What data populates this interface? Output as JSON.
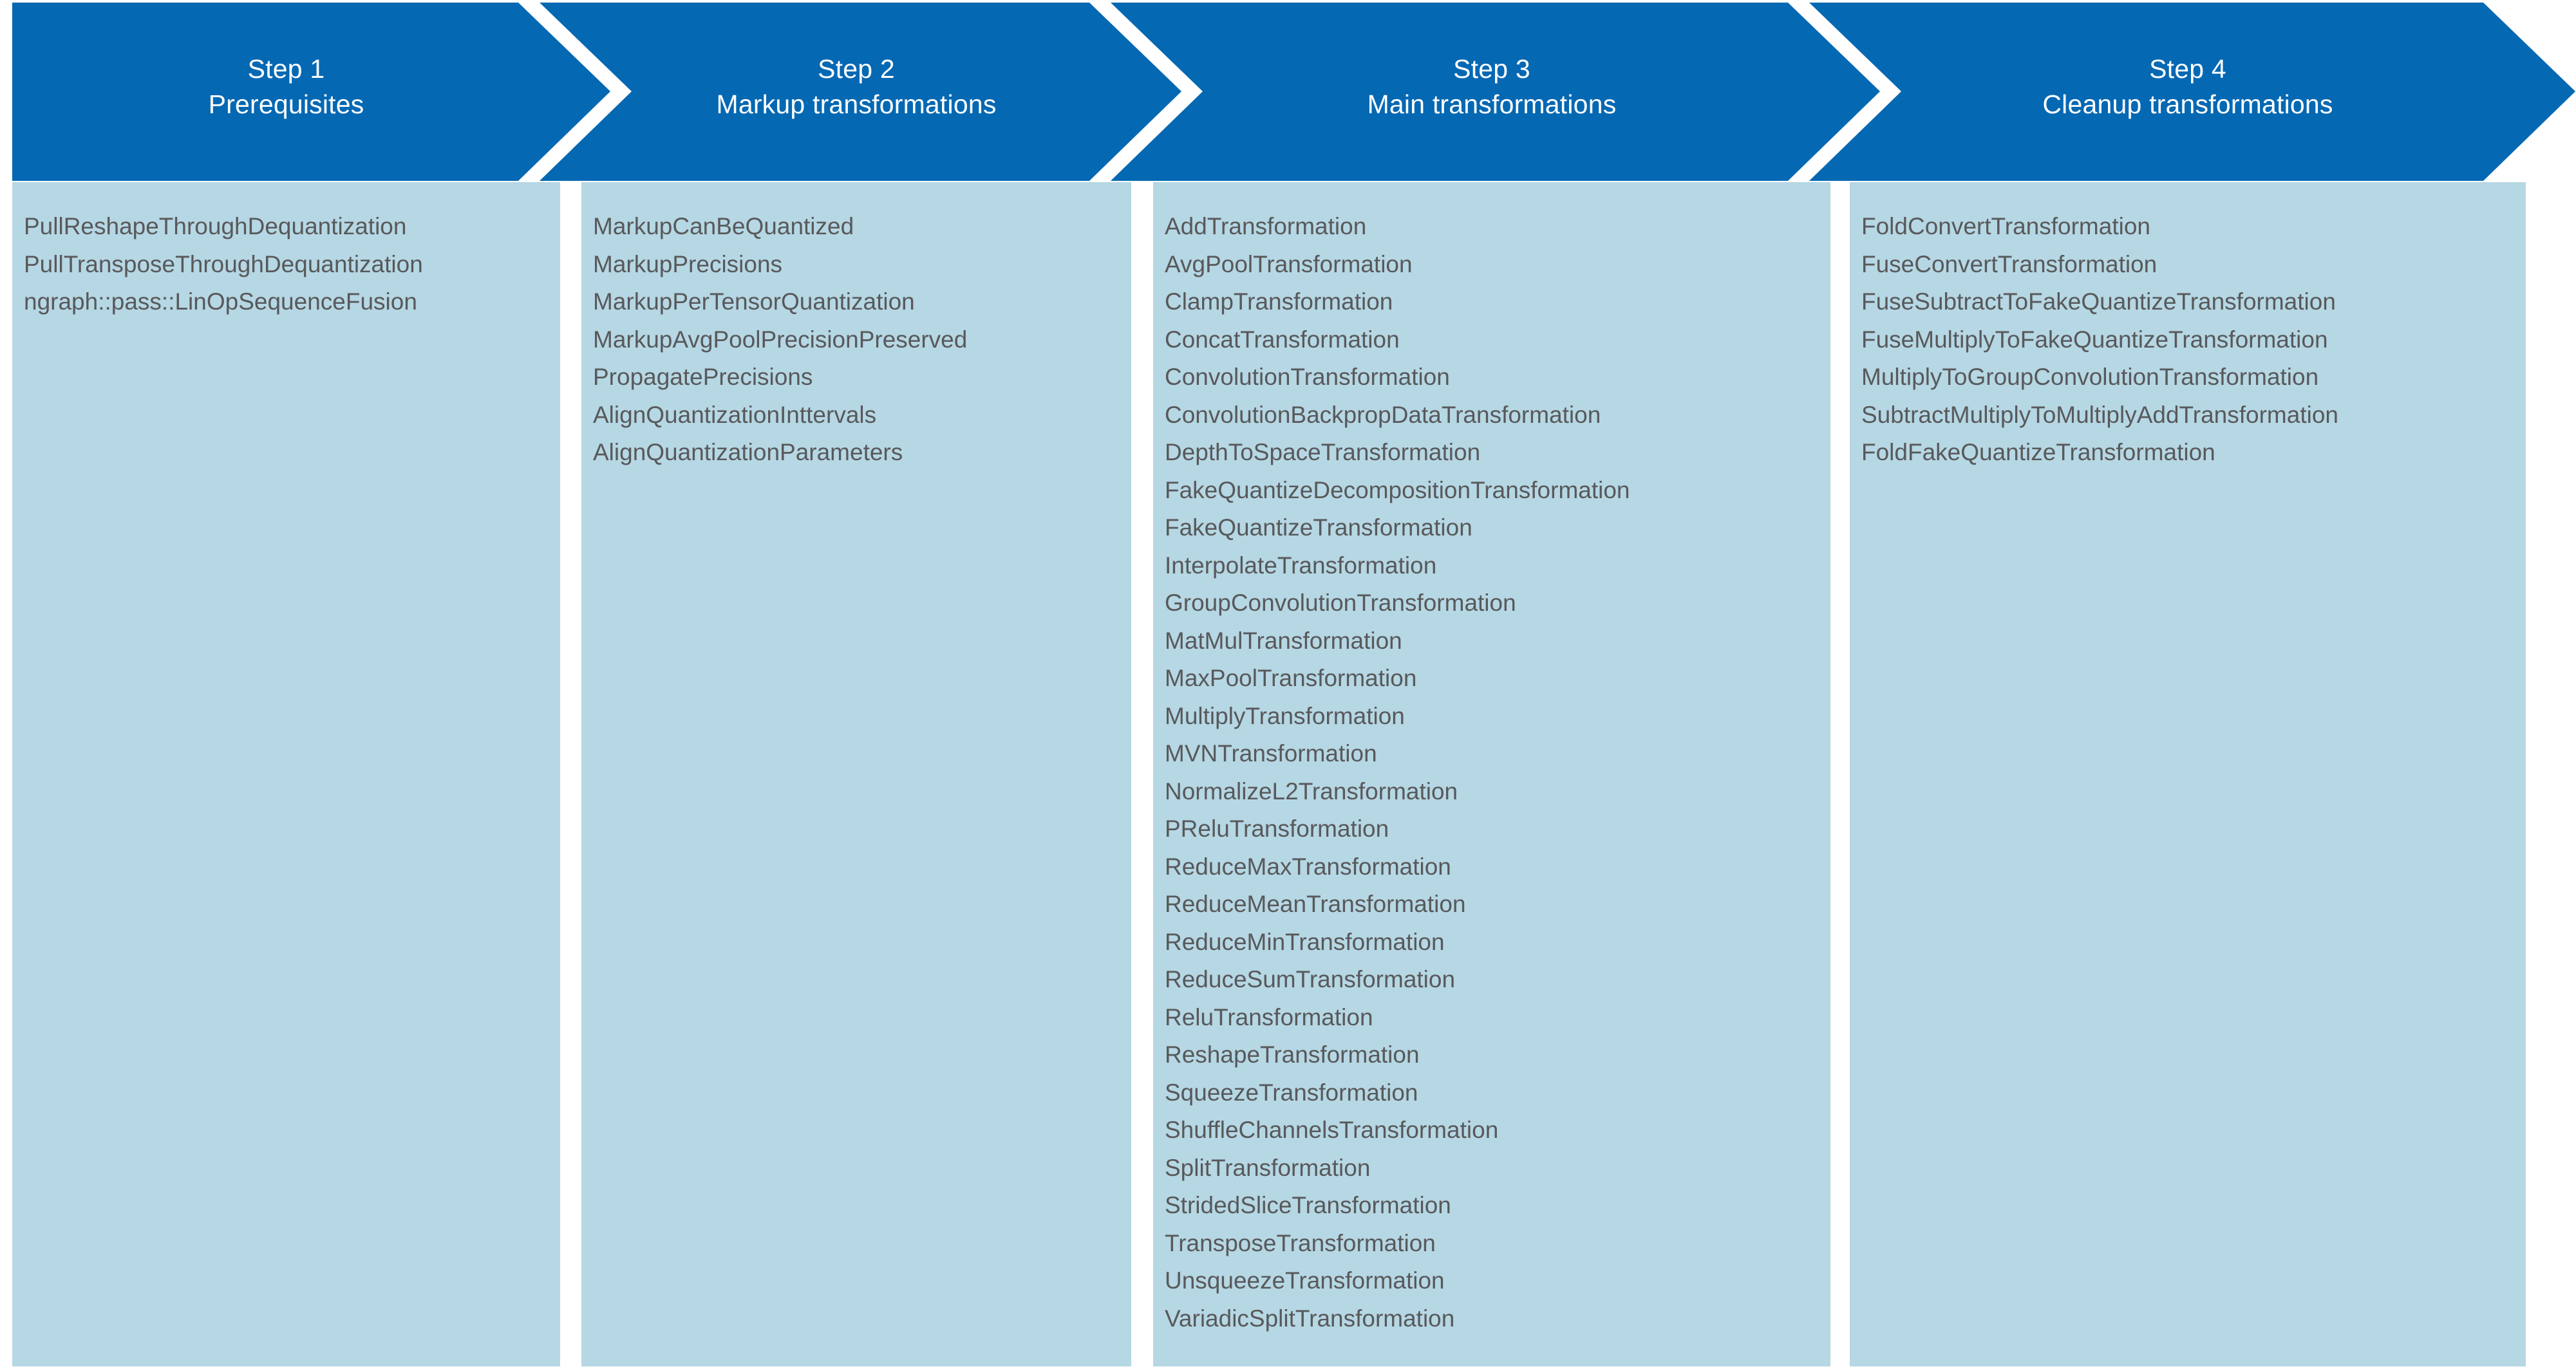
{
  "colors": {
    "header_blue": "#0568b3",
    "panel_blue": "#b6d7e4",
    "header_text": "#ffffff",
    "item_text": "#58595b",
    "background": "#ffffff"
  },
  "steps": [
    {
      "step_label": "Step 1",
      "title": "Prerequisites",
      "items": [
        "PullReshapeThroughDequantization",
        "PullTransposeThroughDequantization",
        "ngraph::pass::LinOpSequenceFusion"
      ]
    },
    {
      "step_label": "Step 2",
      "title": "Markup transformations",
      "items": [
        "MarkupCanBeQuantized",
        "MarkupPrecisions",
        "MarkupPerTensorQuantization",
        "MarkupAvgPoolPrecisionPreserved",
        "PropagatePrecisions",
        "AlignQuantizationInttervals",
        "AlignQuantizationParameters"
      ]
    },
    {
      "step_label": "Step 3",
      "title": "Main transformations",
      "items": [
        "AddTransformation",
        "AvgPoolTransformation",
        "ClampTransformation",
        "ConcatTransformation",
        "ConvolutionTransformation",
        "ConvolutionBackpropDataTransformation",
        "DepthToSpaceTransformation",
        "FakeQuantizeDecompositionTransformation",
        "FakeQuantizeTransformation",
        "InterpolateTransformation",
        "GroupConvolutionTransformation",
        "MatMulTransformation",
        "MaxPoolTransformation",
        "MultiplyTransformation",
        "MVNTransformation",
        "NormalizeL2Transformation",
        "PReluTransformation",
        "ReduceMaxTransformation",
        "ReduceMeanTransformation",
        "ReduceMinTransformation",
        "ReduceSumTransformation",
        "ReluTransformation",
        "ReshapeTransformation",
        "SqueezeTransformation",
        "ShuffleChannelsTransformation",
        "SplitTransformation",
        "StridedSliceTransformation",
        "TransposeTransformation",
        "UnsqueezeTransformation",
        "VariadicSplitTransformation"
      ]
    },
    {
      "step_label": "Step 4",
      "title": "Cleanup transformations",
      "items": [
        "FoldConvertTransformation",
        "FuseConvertTransformation",
        "FuseSubtractToFakeQuantizeTransformation",
        "FuseMultiplyToFakeQuantizeTransformation",
        "MultiplyToGroupConvolutionTransformation",
        "SubtractMultiplyToMultiplyAddTransformation",
        "FoldFakeQuantizeTransformation"
      ]
    }
  ]
}
